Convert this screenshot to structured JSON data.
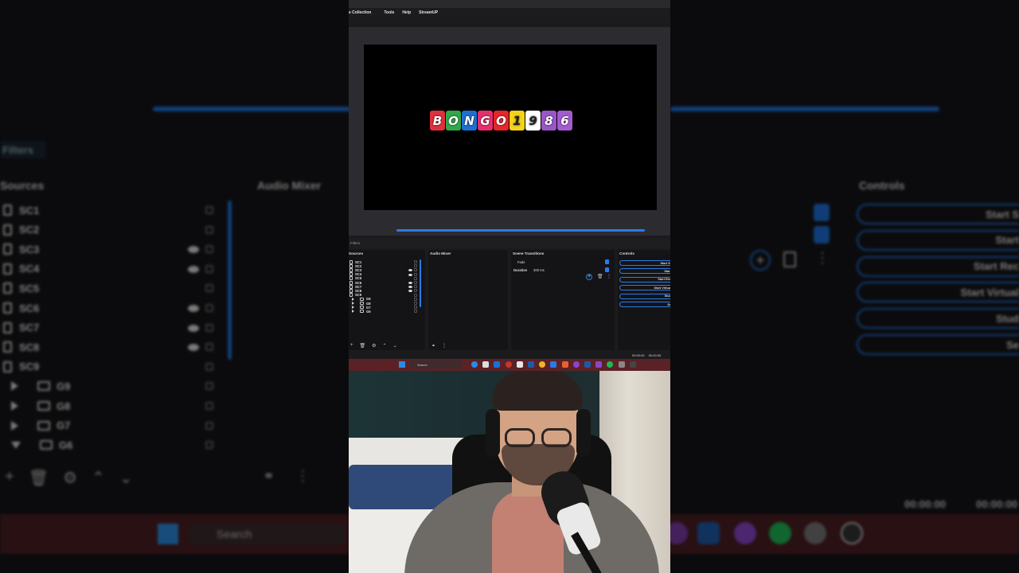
{
  "menu": {
    "items": [
      "e Collection",
      "Tools",
      "Help",
      "StreamUP"
    ]
  },
  "preview": {
    "logo_letters": [
      "B",
      "O",
      "N",
      "G",
      "O",
      "1",
      "9",
      "8",
      "6"
    ],
    "logo_colors": [
      "#e0303d",
      "#33a64a",
      "#1f6fd1",
      "#e6306e",
      "#e5262a",
      "#f4d31a",
      "#ffffff",
      "#9a56c7",
      "#a55bd0"
    ]
  },
  "filters_tab": "Filters",
  "sources": {
    "title": "Sources",
    "items": [
      "SC1",
      "SC2",
      "SC3",
      "SC4",
      "SC5",
      "SC6",
      "SC7",
      "SC8",
      "SC9"
    ],
    "groups": [
      "G9",
      "G8",
      "G7",
      "G6"
    ]
  },
  "audio_mixer": {
    "title": "Audio Mixer"
  },
  "scene_transitions": {
    "title": "Scene Transitions",
    "transition": "Fade",
    "duration_label": "Duration",
    "duration_value": "300 ms"
  },
  "controls": {
    "title": "Controls",
    "buttons": [
      "Start St",
      "Start",
      "Start Rec",
      "Start Virtual",
      "Stud",
      "Se"
    ]
  },
  "timers": {
    "left": "00:00:00",
    "right": "00:00:00"
  },
  "taskbar": {
    "search_placeholder": "Search"
  },
  "background": {
    "filters_label": "Filters",
    "sources_title": "Sources",
    "audio_title": "Audio Mixer",
    "controls_title": "Controls",
    "source_items": [
      "SC1",
      "SC2",
      "SC3",
      "SC4",
      "SC5",
      "SC6",
      "SC7",
      "SC8",
      "SC9"
    ],
    "group_items": [
      "G9",
      "G8",
      "G7",
      "G6"
    ],
    "control_buttons": [
      "Start S",
      "Start",
      "Start Rec",
      "Start Virtual",
      "Stud",
      "Se"
    ],
    "timer_left": "00:00:00",
    "timer_right": "00:00:00",
    "search_placeholder": "Search"
  }
}
